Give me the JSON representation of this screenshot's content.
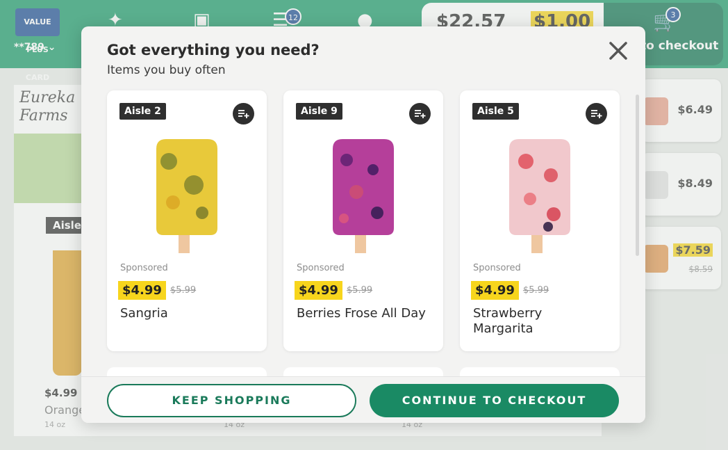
{
  "header": {
    "loyalty_card_label": "VALUE PLUS CARD",
    "card_number": "**789",
    "notifications_count": "12",
    "order_total": "$22.57",
    "savings": "$1.00",
    "checkout_label": "to checkout",
    "cart_count": "3"
  },
  "background": {
    "brand": "Eureka Farms",
    "aisle_label": "Aisle",
    "product_price": "$4.99",
    "product_name": "Orange",
    "sizes": [
      "14 oz",
      "14 oz",
      "14 oz"
    ],
    "side_items": [
      {
        "price": "$6.49"
      },
      {
        "price": "$8.49"
      },
      {
        "price": "$7.59",
        "old_price": "$8.59"
      }
    ]
  },
  "modal": {
    "title": "Got everything you need?",
    "subtitle": "Items you buy often",
    "products": [
      {
        "aisle": "Aisle 2",
        "sponsored": "Sponsored",
        "price": "$4.99",
        "old_price": "$5.99",
        "name": "Sangria",
        "color": "#e8c93a"
      },
      {
        "aisle": "Aisle 9",
        "sponsored": "Sponsored",
        "price": "$4.99",
        "old_price": "$5.99",
        "name": "Berries Frose All Day",
        "color": "#b53f9a"
      },
      {
        "aisle": "Aisle 5",
        "sponsored": "Sponsored",
        "price": "$4.99",
        "old_price": "$5.99",
        "name": "Strawberry Margarita",
        "color": "#f1c8cc"
      }
    ],
    "keep_shopping_label": "KEEP SHOPPING",
    "continue_checkout_label": "CONTINUE TO CHECKOUT"
  },
  "colors": {
    "brand_green": "#1b9a6b",
    "price_highlight": "#f7d51d",
    "checkout_button": "#1a8a64"
  }
}
